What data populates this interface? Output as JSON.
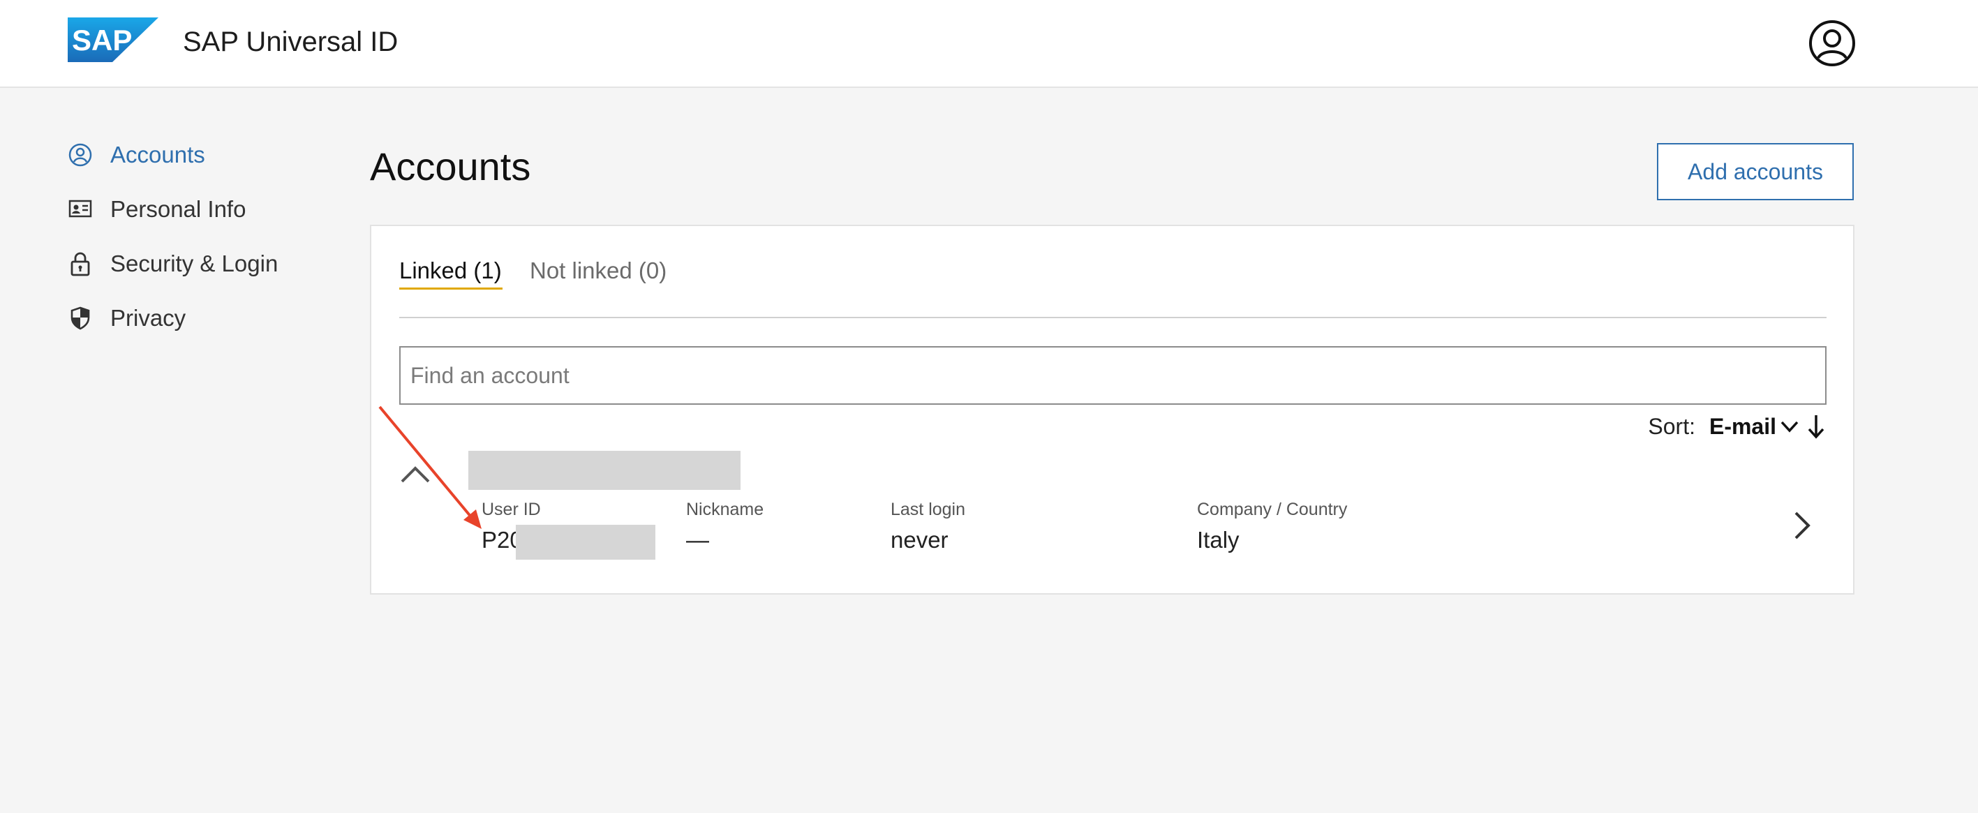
{
  "header": {
    "logo_text": "SAP",
    "app_title": "SAP Universal ID",
    "user_icon": "user-circle-icon"
  },
  "sidebar": {
    "items": [
      {
        "label": "Accounts",
        "icon": "user-circle-icon",
        "active": true
      },
      {
        "label": "Personal Info",
        "icon": "id-card-icon",
        "active": false
      },
      {
        "label": "Security & Login",
        "icon": "lock-icon",
        "active": false
      },
      {
        "label": "Privacy",
        "icon": "shield-icon",
        "active": false
      }
    ]
  },
  "main": {
    "title": "Accounts",
    "add_button_label": "Add accounts",
    "tabs": [
      {
        "label": "Linked (1)",
        "selected": true
      },
      {
        "label": "Not linked (0)",
        "selected": false
      }
    ],
    "search_placeholder": "Find an account",
    "sort": {
      "label": "Sort:",
      "value": "E-mail"
    },
    "account": {
      "fields": [
        {
          "label": "User ID",
          "value": "P20"
        },
        {
          "label": "Nickname",
          "value": "—"
        },
        {
          "label": "Last login",
          "value": "never"
        },
        {
          "label": "Company / Country",
          "value": "Italy"
        }
      ]
    }
  },
  "colors": {
    "accent": "#2f6fae",
    "tab_underline": "#e0a800",
    "annotation": "#e8432a",
    "background": "#f5f5f5"
  }
}
